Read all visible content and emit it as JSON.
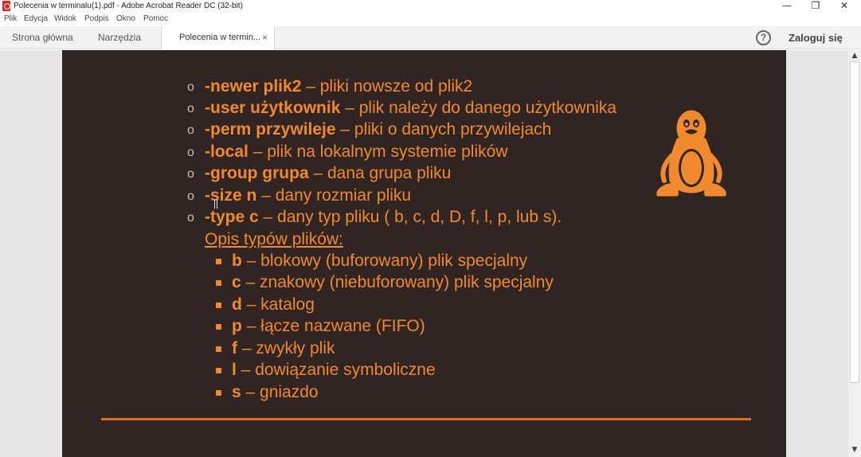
{
  "window": {
    "title": "Polecenia w terminalu(1).pdf - Adobe Acrobat Reader DC (32-bit)",
    "minimize_glyph": "—",
    "restore_glyph": "❐",
    "close_glyph": "✕"
  },
  "menu": {
    "items": [
      "Plik",
      "Edycja",
      "Widok",
      "Podpis",
      "Okno",
      "Pomoc"
    ]
  },
  "tabs": {
    "home": "Strona główna",
    "tools": "Narzędzia",
    "document": "Polecenia w termin...",
    "close_glyph": "×"
  },
  "header": {
    "help_glyph": "?",
    "sign_in": "Zaloguj się"
  },
  "slide": {
    "options": [
      {
        "flag": "-newer plik2",
        "desc": " – pliki nowsze od plik2"
      },
      {
        "flag": "-user użytkownik",
        "desc": " – plik należy do danego użytkownika"
      },
      {
        "flag": "-perm przywileje",
        "desc": " – pliki o danych przywilejach"
      },
      {
        "flag": "-local",
        "desc": " – plik na lokalnym systemie plików"
      },
      {
        "flag": "-group grupa",
        "desc": " – dana grupa pliku"
      },
      {
        "flag": "-size n",
        "desc": " – dany rozmiar pliku"
      },
      {
        "flag": "-type c",
        "desc": " – dany typ pliku ( b, c, d, D, f, l, p, lub s)."
      }
    ],
    "subheading": "Opis typów plików:",
    "file_types": [
      {
        "code": "b",
        "desc": " – blokowy (buforowany) plik specjalny"
      },
      {
        "code": "c",
        "desc": " – znakowy (niebuforowany) plik specjalny"
      },
      {
        "code": "d",
        "desc": " – katalog"
      },
      {
        "code": "p",
        "desc": " – łącze nazwane (FIFO)"
      },
      {
        "code": "f",
        "desc": " – zwykły plik"
      },
      {
        "code": "l",
        "desc": " – dowiązanie symboliczne"
      },
      {
        "code": "s",
        "desc": " – gniazdo"
      }
    ],
    "bullet_glyph": "o"
  },
  "scrollbar": {
    "up_glyph": "▲",
    "down_glyph": "▼"
  },
  "colors": {
    "slide_background": "#302523",
    "accent_orange": "#f08a2c",
    "divider": "#e06e1b",
    "acrobat_red": "#e1251b"
  },
  "icons": {
    "app": "acrobat-pdf-icon",
    "mascot": "tux-penguin-icon",
    "help": "help-circle-icon"
  }
}
